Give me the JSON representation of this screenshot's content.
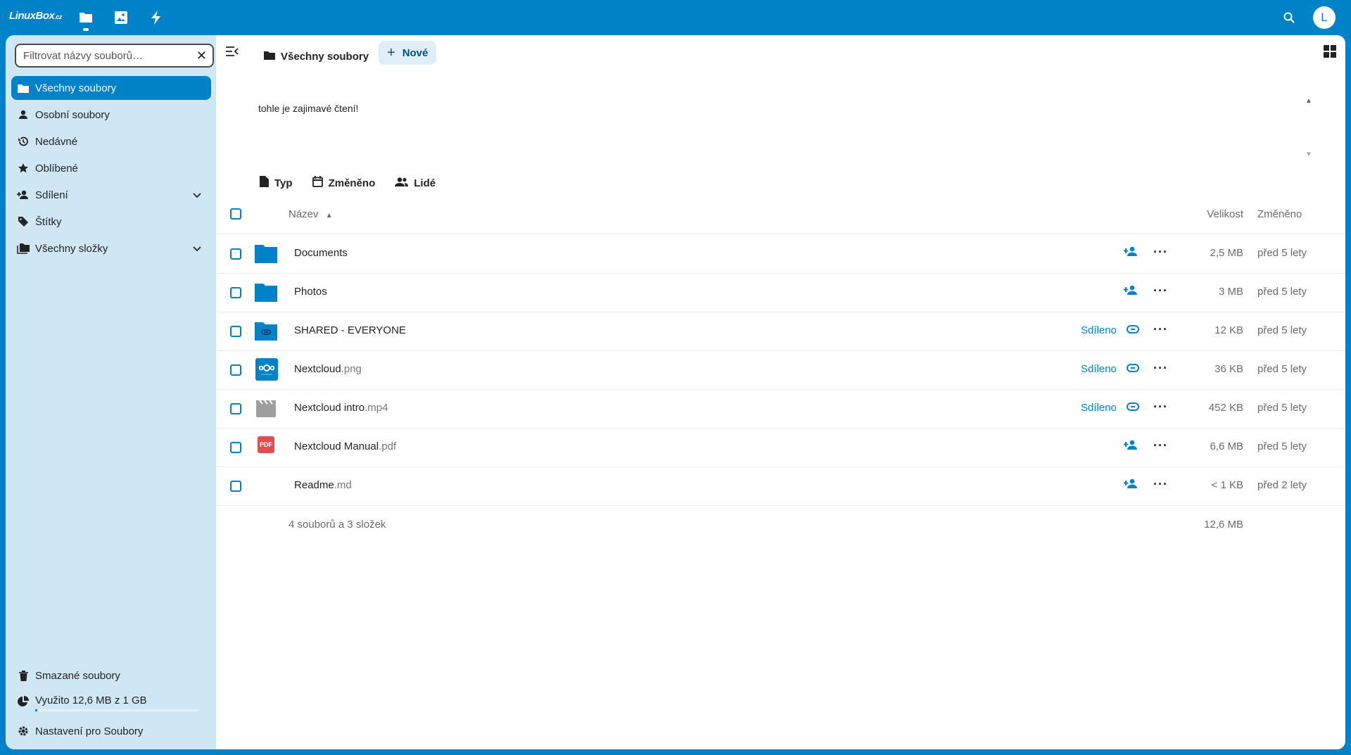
{
  "header": {
    "logo_main": "LinuxBox",
    "logo_tld": ".cz",
    "apps": [
      {
        "name": "files",
        "icon": "folder-icon",
        "active": true
      },
      {
        "name": "photos",
        "icon": "image-icon",
        "active": false
      },
      {
        "name": "activity",
        "icon": "lightning-icon",
        "active": false
      }
    ],
    "avatar_initial": "L"
  },
  "sidebar": {
    "filter_placeholder": "Filtrovat názvy souborů…",
    "items": [
      {
        "label": "Všechny soubory",
        "icon": "folder-icon",
        "active": true
      },
      {
        "label": "Osobní soubory",
        "icon": "person-icon"
      },
      {
        "label": "Nedávné",
        "icon": "history-icon"
      },
      {
        "label": "Oblíbené",
        "icon": "star-icon"
      },
      {
        "label": "Sdílení",
        "icon": "share-icon",
        "expandable": true
      },
      {
        "label": "Štítky",
        "icon": "tag-icon"
      },
      {
        "label": "Všechny složky",
        "icon": "folders-icon",
        "expandable": true
      }
    ],
    "bottom": {
      "trash": "Smazané soubory",
      "quota": "Využito 12,6 MB z 1 GB",
      "quota_fraction": 0.0126,
      "settings": "Nastavení pro Soubory"
    }
  },
  "main": {
    "breadcrumb": "Všechny soubory",
    "new_button": "Nové",
    "description": "tohle je zajimavé čtení!",
    "filters": [
      "Typ",
      "Změněno",
      "Lidé"
    ],
    "columns": {
      "name": "Název",
      "size": "Velikost",
      "modified": "Změněno"
    },
    "files": [
      {
        "name": "Documents",
        "ext": "",
        "type": "folder",
        "shared": false,
        "size": "2,5 MB",
        "modified": "před 5 lety"
      },
      {
        "name": "Photos",
        "ext": "",
        "type": "folder",
        "shared": false,
        "size": "3 MB",
        "modified": "před 5 lety"
      },
      {
        "name": "SHARED - EVERYONE",
        "ext": "",
        "type": "folder-link",
        "shared": true,
        "size": "12 KB",
        "modified": "před 5 lety"
      },
      {
        "name": "Nextcloud",
        "ext": ".png",
        "type": "image",
        "shared": true,
        "size": "36 KB",
        "modified": "před 5 lety"
      },
      {
        "name": "Nextcloud intro",
        "ext": ".mp4",
        "type": "video",
        "shared": true,
        "size": "452 KB",
        "modified": "před 5 lety"
      },
      {
        "name": "Nextcloud Manual",
        "ext": ".pdf",
        "type": "pdf",
        "shared": false,
        "size": "6,6 MB",
        "modified": "před 5 lety"
      },
      {
        "name": "Readme",
        "ext": ".md",
        "type": "text",
        "shared": false,
        "size": "< 1 KB",
        "modified": "před 2 lety"
      }
    ],
    "shared_label": "Sdíleno",
    "pdf_badge": "PDF",
    "summary": "4 souborů a 3 složek",
    "summary_size": "12,6 MB",
    "colors": {
      "primary": "#0082c9",
      "sidebar": "#cfe6f4",
      "pdf": "#e24c4b"
    }
  }
}
